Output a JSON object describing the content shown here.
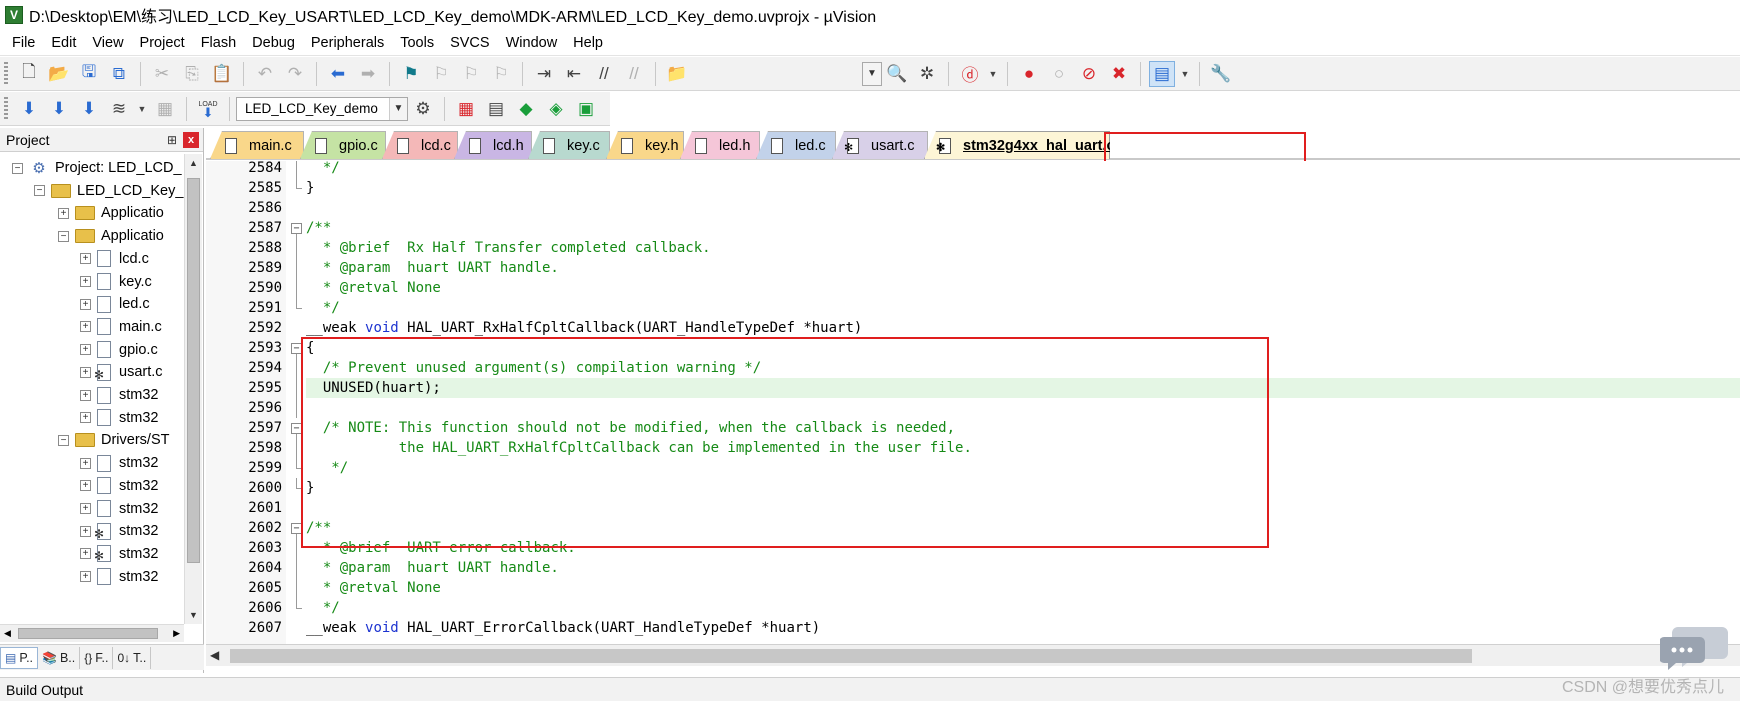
{
  "window": {
    "title": "D:\\Desktop\\EM\\练习\\LED_LCD_Key_USART\\LED_LCD_Key_demo\\MDK-ARM\\LED_LCD_Key_demo.uvprojx - µVision"
  },
  "menubar": {
    "items": [
      "File",
      "Edit",
      "View",
      "Project",
      "Flash",
      "Debug",
      "Peripherals",
      "Tools",
      "SVCS",
      "Window",
      "Help"
    ]
  },
  "toolbar": {
    "target_combo": "LED_LCD_Key_demo",
    "load_label": "LOAD"
  },
  "sidebar": {
    "title": "Project",
    "pin_glyph": "⊞",
    "close_glyph": "x",
    "tree": [
      {
        "label": "Project: LED_LCD_",
        "toggle": "−",
        "icon": "project"
      },
      {
        "label": "LED_LCD_Key_",
        "toggle": "−",
        "icon": "folder-open"
      },
      {
        "label": "Applicatio",
        "toggle": "+",
        "icon": "folder"
      },
      {
        "label": "Applicatio",
        "toggle": "−",
        "icon": "folder-open"
      },
      {
        "label": "lcd.c",
        "toggle": "+",
        "icon": "file"
      },
      {
        "label": "key.c",
        "toggle": "+",
        "icon": "file"
      },
      {
        "label": "led.c",
        "toggle": "+",
        "icon": "file"
      },
      {
        "label": "main.c",
        "toggle": "+",
        "icon": "file"
      },
      {
        "label": "gpio.c",
        "toggle": "+",
        "icon": "file"
      },
      {
        "label": "usart.c",
        "toggle": "+",
        "icon": "file-gear"
      },
      {
        "label": "stm32",
        "toggle": "+",
        "icon": "file"
      },
      {
        "label": "stm32",
        "toggle": "+",
        "icon": "file"
      },
      {
        "label": "Drivers/ST",
        "toggle": "−",
        "icon": "folder-open"
      },
      {
        "label": "stm32",
        "toggle": "+",
        "icon": "file"
      },
      {
        "label": "stm32",
        "toggle": "+",
        "icon": "file"
      },
      {
        "label": "stm32",
        "toggle": "+",
        "icon": "file"
      },
      {
        "label": "stm32",
        "toggle": "+",
        "icon": "file-gear"
      },
      {
        "label": "stm32",
        "toggle": "+",
        "icon": "file-gear"
      },
      {
        "label": "stm32",
        "toggle": "+",
        "icon": "file"
      }
    ],
    "bottom_tabs": [
      "P..",
      "B..",
      "F..",
      "T.."
    ]
  },
  "editor": {
    "tabs": [
      {
        "label": "main.c",
        "color": "#f9d78a",
        "active": false
      },
      {
        "label": "gpio.c",
        "color": "#c5e3a4",
        "active": false
      },
      {
        "label": "lcd.c",
        "color": "#f4b8b8",
        "active": false
      },
      {
        "label": "lcd.h",
        "color": "#c9b6e4",
        "active": false
      },
      {
        "label": "key.c",
        "color": "#b8d9cf",
        "active": false
      },
      {
        "label": "key.h",
        "color": "#f9d78a",
        "active": false
      },
      {
        "label": "led.h",
        "color": "#f5c6d8",
        "active": false
      },
      {
        "label": "led.c",
        "color": "#c2d2ea",
        "active": false
      },
      {
        "label": "usart.c",
        "color": "#d8d0e8",
        "active": false
      },
      {
        "label": "stm32g4xx_hal_uart.c",
        "color": "#fdf5d6",
        "active": true
      }
    ],
    "lines": [
      {
        "n": "2584",
        "fold": "line",
        "segs": [
          {
            "t": "  */",
            "c": "cm"
          }
        ]
      },
      {
        "n": "2585",
        "fold": "end",
        "segs": [
          {
            "t": "}",
            "c": "tx"
          }
        ]
      },
      {
        "n": "2586",
        "fold": "",
        "segs": []
      },
      {
        "n": "2587",
        "fold": "box",
        "segs": [
          {
            "t": "/**",
            "c": "cm"
          }
        ]
      },
      {
        "n": "2588",
        "fold": "line",
        "segs": [
          {
            "t": "  * @brief  Rx Half Transfer completed callback.",
            "c": "cm"
          }
        ]
      },
      {
        "n": "2589",
        "fold": "line",
        "segs": [
          {
            "t": "  * @param  huart UART handle.",
            "c": "cm"
          }
        ]
      },
      {
        "n": "2590",
        "fold": "line",
        "segs": [
          {
            "t": "  * @retval None",
            "c": "cm"
          }
        ]
      },
      {
        "n": "2591",
        "fold": "end",
        "segs": [
          {
            "t": "  */",
            "c": "cm"
          }
        ]
      },
      {
        "n": "2592",
        "fold": "",
        "segs": [
          {
            "t": "__weak ",
            "c": "tx"
          },
          {
            "t": "void",
            "c": "kw"
          },
          {
            "t": " HAL_UART_RxHalfCpltCallback(UART_HandleTypeDef *huart)",
            "c": "tx"
          }
        ]
      },
      {
        "n": "2593",
        "fold": "box",
        "segs": [
          {
            "t": "{",
            "c": "tx"
          }
        ]
      },
      {
        "n": "2594",
        "fold": "line",
        "segs": [
          {
            "t": "  /* Prevent unused argument(s) compilation warning */",
            "c": "cm"
          }
        ]
      },
      {
        "n": "2595",
        "fold": "line",
        "hl": true,
        "segs": [
          {
            "t": "  UNUSED(huart);",
            "c": "tx"
          }
        ]
      },
      {
        "n": "2596",
        "fold": "line",
        "segs": []
      },
      {
        "n": "2597",
        "fold": "box",
        "segs": [
          {
            "t": "  /* NOTE: This function should not be modified, when the callback is needed,",
            "c": "cm"
          }
        ]
      },
      {
        "n": "2598",
        "fold": "line",
        "segs": [
          {
            "t": "           the HAL_UART_RxHalfCpltCallback can be implemented in the user file.",
            "c": "cm"
          }
        ]
      },
      {
        "n": "2599",
        "fold": "end",
        "segs": [
          {
            "t": "   */",
            "c": "cm"
          }
        ]
      },
      {
        "n": "2600",
        "fold": "end",
        "segs": [
          {
            "t": "}",
            "c": "tx"
          }
        ]
      },
      {
        "n": "2601",
        "fold": "",
        "segs": []
      },
      {
        "n": "2602",
        "fold": "box",
        "segs": [
          {
            "t": "/**",
            "c": "cm"
          }
        ]
      },
      {
        "n": "2603",
        "fold": "line",
        "segs": [
          {
            "t": "  * @brief  UART error callback.",
            "c": "cm"
          }
        ]
      },
      {
        "n": "2604",
        "fold": "line",
        "segs": [
          {
            "t": "  * @param  huart UART handle.",
            "c": "cm"
          }
        ]
      },
      {
        "n": "2605",
        "fold": "line",
        "segs": [
          {
            "t": "  * @retval None",
            "c": "cm"
          }
        ]
      },
      {
        "n": "2606",
        "fold": "end",
        "segs": [
          {
            "t": "  */",
            "c": "cm"
          }
        ]
      },
      {
        "n": "2607",
        "fold": "",
        "segs": [
          {
            "t": "__weak ",
            "c": "tx"
          },
          {
            "t": "void",
            "c": "kw"
          },
          {
            "t": " HAL_UART_ErrorCallback(UART_HandleTypeDef *huart)",
            "c": "tx"
          }
        ]
      }
    ]
  },
  "bottom": {
    "build_output": "Build Output",
    "watermark": "CSDN @想要优秀点儿"
  }
}
